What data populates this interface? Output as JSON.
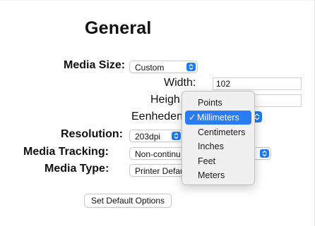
{
  "title": "General",
  "media_size": {
    "label": "Media Size:",
    "value": "Custom"
  },
  "width": {
    "label": "Width:",
    "value": "102"
  },
  "height": {
    "label": "Heigh"
  },
  "units": {
    "label": "Eenheden"
  },
  "resolution": {
    "label": "Resolution:",
    "value": "203dpi"
  },
  "media_tracking": {
    "label": "Media Tracking:",
    "value": "Non-continu"
  },
  "media_type": {
    "label": "Media Type:",
    "value": "Printer Defau"
  },
  "set_default_button": "Set Default Options",
  "unit_menu": {
    "items": [
      "Points",
      "Millimeters",
      "Centimeters",
      "Inches",
      "Feet",
      "Meters"
    ],
    "selected_check": "✓"
  },
  "colors": {
    "accent": "#2a7cf3",
    "stepper": "#1f7bf5"
  }
}
